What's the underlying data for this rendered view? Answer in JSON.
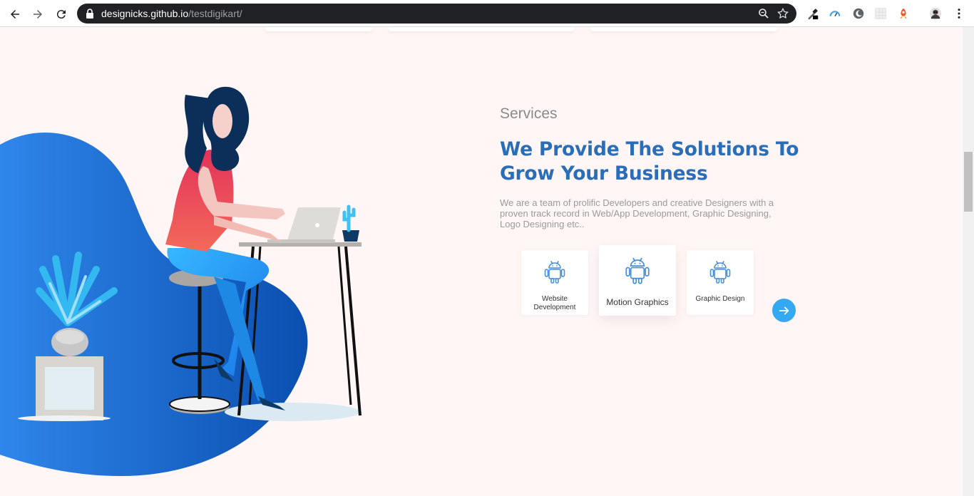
{
  "browser": {
    "url_host": "designicks.github.io",
    "url_path": "/testdigikart/"
  },
  "services": {
    "section_label": "Services",
    "headline": "We Provide The Solutions To Grow Your Business",
    "description": "We are a team of prolific Developers and creative Designers with a proven track record in Web/App Development, Graphic Designing, Logo Designing etc..",
    "cards": [
      {
        "label": "Website Development",
        "icon": "android-icon"
      },
      {
        "label": "Motion Graphics",
        "icon": "android-icon"
      },
      {
        "label": "Graphic Design",
        "icon": "android-icon"
      }
    ],
    "next_icon": "arrow-right-icon"
  },
  "colors": {
    "page_bg": "#fff6f5",
    "headline": "#2a6db8",
    "accent": "#34a9f2",
    "blob": "#1e6fd9"
  }
}
